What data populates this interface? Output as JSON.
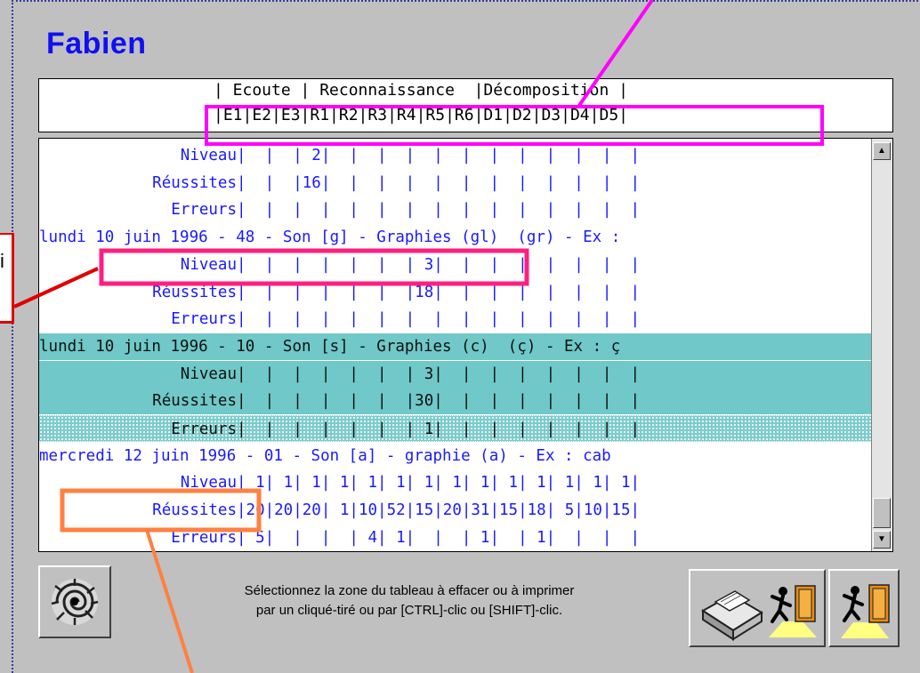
{
  "window": {
    "title": "Fabien"
  },
  "header": {
    "groups_line": "| Ecoute | Reconnaissance  |Décomposition |",
    "columns_line": "|E1|E2|E3|R1|R2|R3|R4|R5|R6|D1|D2|D3|D4|D5|"
  },
  "table": {
    "rows": [
      {
        "label": "Niveau",
        "cells": "|  |  | 2|  |  |  |  |  |  |  |  |  |  |  |"
      },
      {
        "label": "Réussites",
        "cells": "|  |  |16|  |  |  |  |  |  |  |  |  |  |  |"
      },
      {
        "label": "Erreurs",
        "cells": "|  |  |  |  |  |  |  |  |  |  |  |  |  |  |"
      },
      {
        "date": "lundi 10 juin 1996 - 48 - Son [g] - Graphies (gl)  (gr) - Ex : "
      },
      {
        "label": "Niveau",
        "cells": "|  |  |  |  |  |  | 3|  |  |  |  |  |  |  |"
      },
      {
        "label": "Réussites",
        "cells": "|  |  |  |  |  |  |18|  |  |  |  |  |  |  |"
      },
      {
        "label": "Erreurs",
        "cells": "|  |  |  |  |  |  |  |  |  |  |  |  |  |  |"
      },
      {
        "date": "lundi 10 juin 1996 - 10 - Son [s] - Graphies (c)  (ç) - Ex : ç"
      },
      {
        "label": "Niveau",
        "cells": "|  |  |  |  |  |  | 3|  |  |  |  |  |  |  |"
      },
      {
        "label": "Réussites",
        "cells": "|  |  |  |  |  |  |30|  |  |  |  |  |  |  |"
      },
      {
        "label": "Erreurs",
        "cells": "|  |  |  |  |  |  | 1|  |  |  |  |  |  |  |"
      },
      {
        "date": "mercredi 12 juin 1996 - 01 - Son [a] - graphie (a) - Ex : cab"
      },
      {
        "label": "Niveau",
        "cells": "| 1| 1| 1| 1| 1| 1| 1| 1| 1| 1| 1| 1| 1| 1|"
      },
      {
        "label": "Réussites",
        "cells": "|20|20|20| 1|10|52|15|20|31|15|18| 5|10|15|"
      },
      {
        "label": "Erreurs",
        "cells": "| 5|  |  |  | 4| 1|  |  | 1|  | 1|  |  |  |"
      }
    ]
  },
  "scrollbar": {
    "up_glyph": "▲",
    "down_glyph": "▼"
  },
  "footer": {
    "instruction_line1": "Sélectionnez la zone du tableau à effacer ou à imprimer",
    "instruction_line2": "par un cliqué-tiré ou par [CTRL]-clic ou [SHIFT]-clic.",
    "left_button_icon": "vortex-erase-icon",
    "print_exit_button_icon": "printer-exit-icon",
    "exit_button_icon": "exit-door-icon"
  },
  "callouts": {
    "left_label": "i"
  },
  "colors": {
    "title": "#1010f0",
    "row_text": "#1a1aff",
    "selection": "#70c8c8",
    "annotation_magenta": "#ff00ff",
    "annotation_pink": "#ff1f7f",
    "annotation_orange": "#ff8040",
    "annotation_red": "#e00000"
  }
}
